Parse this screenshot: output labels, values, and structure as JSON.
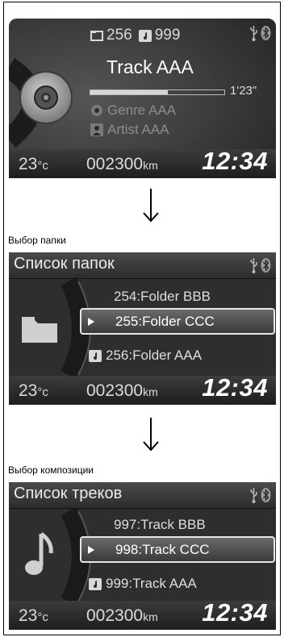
{
  "now_playing": {
    "folder_count": "256",
    "track_count": "999",
    "track": "Track AAA",
    "progress": 0.58,
    "elapsed": "1'23\"",
    "genre": "Genre AAA",
    "artist": "Artist AAA"
  },
  "status": {
    "temperature": "23",
    "temperature_unit": "°c",
    "odometer": "002300",
    "odometer_unit": "km",
    "clock": "12:34"
  },
  "folder_section": {
    "caption": "Выбор папки",
    "title": "Список папок",
    "items": [
      "254:Folder BBB",
      "255:Folder CCC",
      "256:Folder AAA"
    ],
    "selected_index": 1
  },
  "track_section": {
    "caption": "Выбор композиции",
    "title": "Список треков",
    "items": [
      "997:Track BBB",
      "998:Track CCC",
      "999:Track AAA"
    ],
    "selected_index": 1
  },
  "icons": [
    "folder-icon",
    "music-note-icon",
    "cd-disc-icon",
    "usb-icon",
    "bluetooth-icon",
    "genre-icon",
    "artist-icon",
    "down-arrow-icon"
  ]
}
